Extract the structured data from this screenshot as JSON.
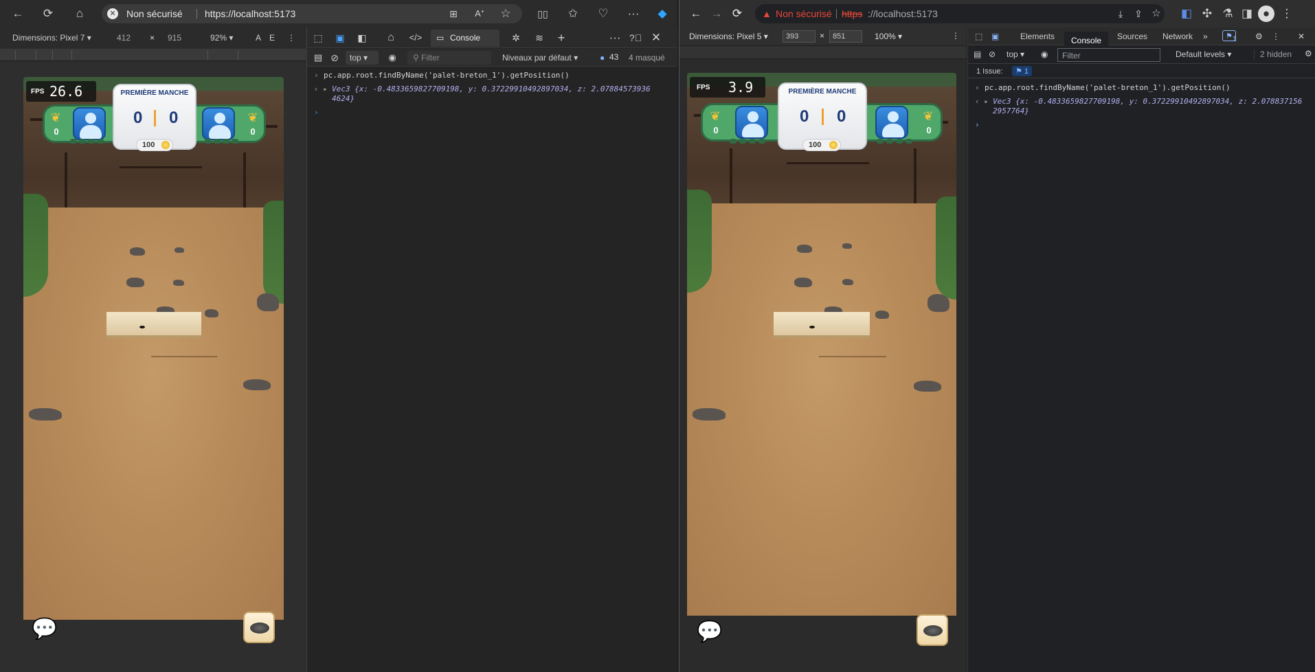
{
  "left": {
    "security_label": "Non sécurisé",
    "url": "https://localhost:5173",
    "device": "Dimensions: Pixel 7",
    "width": "412",
    "x": "×",
    "height": "915",
    "zoom": "92%",
    "a_label": "A",
    "e_label": "E",
    "console_tab": "Console",
    "context": "top",
    "filter_placeholder": "Filter",
    "levels": "Niveaux par défaut",
    "msg_count": "43",
    "hidden": "4 masqué",
    "cmd": "pc.app.root.findByName('palet-breton_1').getPosition()",
    "result_line1": "Vec3 {x: -0.4833659827709198, y: 0.37229910492897034, z: 2.07884573936",
    "result_line2": "4624}",
    "game": {
      "fps_label": "FPS",
      "fps": "26.6",
      "round_title": "PREMIÈRE MANCHE",
      "score_left": "0",
      "score_right": "0",
      "side_left": "0",
      "side_right": "0",
      "coins": "100"
    }
  },
  "right": {
    "security_label": "Non sécurisé",
    "url": "https://localhost:5173",
    "device": "Dimensions: Pixel 5",
    "width": "393",
    "x": "×",
    "height": "851",
    "zoom": "100%",
    "tabs": [
      "Elements",
      "Console",
      "Sources",
      "Network"
    ],
    "issue_badge": "1",
    "context": "top",
    "filter_placeholder": "Filter",
    "levels": "Default levels",
    "hidden": "2 hidden",
    "issues": "1 Issue:",
    "issues_count": "1",
    "cmd": "pc.app.root.findByName('palet-breton_1').getPosition()",
    "result_line1": "Vec3 {x: -0.4833659827709198, y: 0.37229910492897034, z: 2.078837156",
    "result_line2": "2957764}",
    "game": {
      "fps_label": "FPS",
      "fps": "3.9",
      "round_title": "PREMIÈRE MANCHE",
      "score_left": "0",
      "score_right": "0",
      "side_left": "0",
      "side_right": "0",
      "coins": "100"
    }
  },
  "colors": {
    "accent_edge": "#2f7fe0",
    "warning_red": "#e8483b",
    "hud_green": "#4fa76a",
    "hud_blue": "#1e3a78"
  }
}
